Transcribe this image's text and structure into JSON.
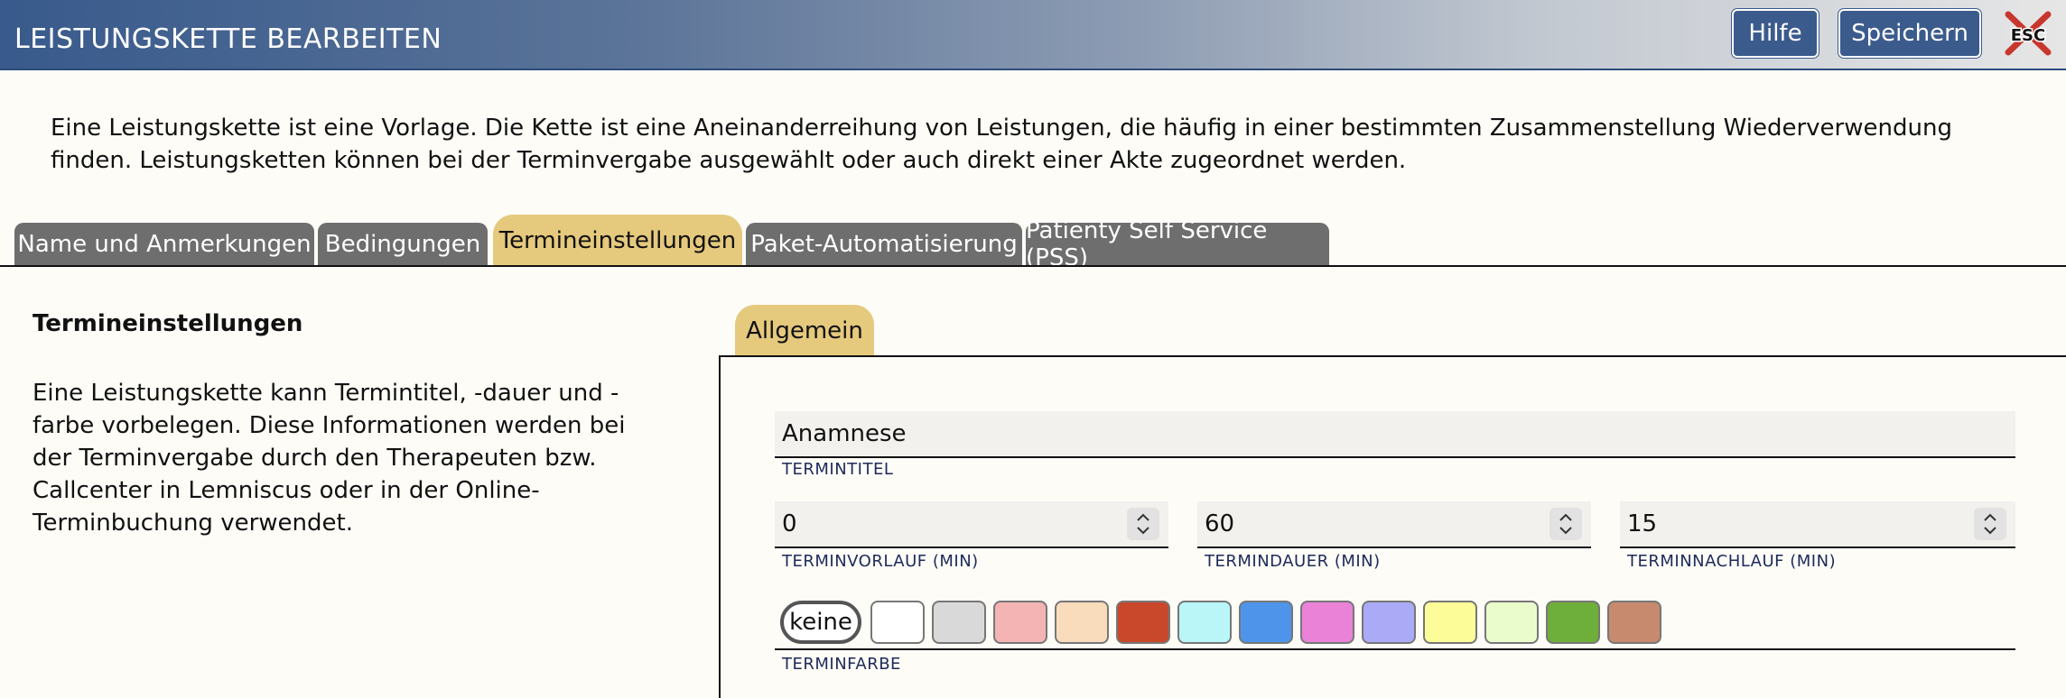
{
  "header": {
    "title": "LEISTUNGSKETTE BEARBEITEN",
    "help_label": "Hilfe",
    "save_label": "Speichern",
    "esc_label": "ESC"
  },
  "intro": {
    "text": "Eine Leistungskette ist eine Vorlage. Die Kette ist eine Aneinanderreihung von Leistungen, die häufig in einer bestimmten Zusammenstellung Wiederverwendung finden. Leistungsketten können bei der Terminvergabe ausgewählt oder auch direkt einer Akte zugeordnet werden."
  },
  "tabs": [
    {
      "label": "Name und Anmerkungen"
    },
    {
      "label": "Bedingungen"
    },
    {
      "label": "Termineinstellungen",
      "active": true
    },
    {
      "label": "Paket-Automatisierung"
    },
    {
      "label": "Patienty Self Service (PSS)"
    }
  ],
  "section": {
    "title": "Termineinstellungen",
    "description": "Eine Leistungskette kann Termintitel, -dauer und -farbe vorbelegen. Diese Informationen werden bei der Terminvergabe durch den Therapeuten bzw. Callcenter in Lemniscus oder in der Online-Terminbuchung verwendet."
  },
  "subtab": {
    "label": "Allgemein"
  },
  "form": {
    "title_value": "Anamnese",
    "title_label": "TERMINTITEL",
    "vorlauf_value": "0",
    "vorlauf_label": "TERMINVORLAUF (MIN)",
    "dauer_value": "60",
    "dauer_label": "TERMINDAUER (MIN)",
    "nachlauf_value": "15",
    "nachlauf_label": "TERMINNACHLAUF (MIN)",
    "color_none_label": "keine",
    "color_label": "TERMINFARBE",
    "colors": [
      "#ffffff",
      "#d9d9d9",
      "#f4b4b4",
      "#f8dcbc",
      "#c9472a",
      "#baf6f8",
      "#4d94ea",
      "#ea82d8",
      "#aaaaf6",
      "#fcfc98",
      "#eafccc",
      "#6eae3a",
      "#c88a6e"
    ]
  },
  "accent_color": "#e5c97d",
  "header_color": "#3b5b8c"
}
